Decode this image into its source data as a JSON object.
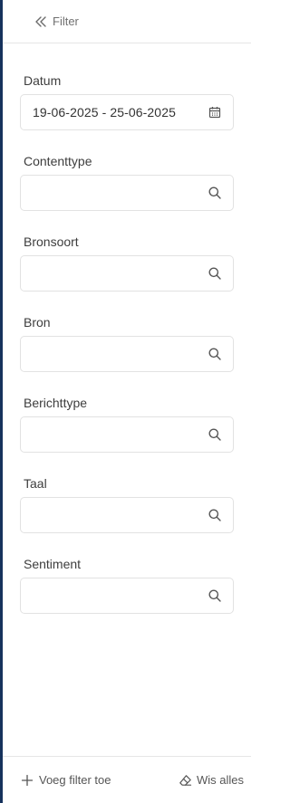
{
  "header": {
    "title": "Filter"
  },
  "filters": [
    {
      "label": "Datum",
      "value": "19-06-2025 - 25-06-2025",
      "icon": "calendar-icon"
    },
    {
      "label": "Contenttype",
      "value": "",
      "icon": "search-icon"
    },
    {
      "label": "Bronsoort",
      "value": "",
      "icon": "search-icon"
    },
    {
      "label": "Bron",
      "value": "",
      "icon": "search-icon"
    },
    {
      "label": "Berichttype",
      "value": "",
      "icon": "search-icon"
    },
    {
      "label": "Taal",
      "value": "",
      "icon": "search-icon"
    },
    {
      "label": "Sentiment",
      "value": "",
      "icon": "search-icon"
    }
  ],
  "footer": {
    "add_label": "Voeg filter toe",
    "clear_label": "Wis alles"
  },
  "colors": {
    "rail": "#16325c",
    "border": "#e2e2e2",
    "icon": "#555555"
  }
}
